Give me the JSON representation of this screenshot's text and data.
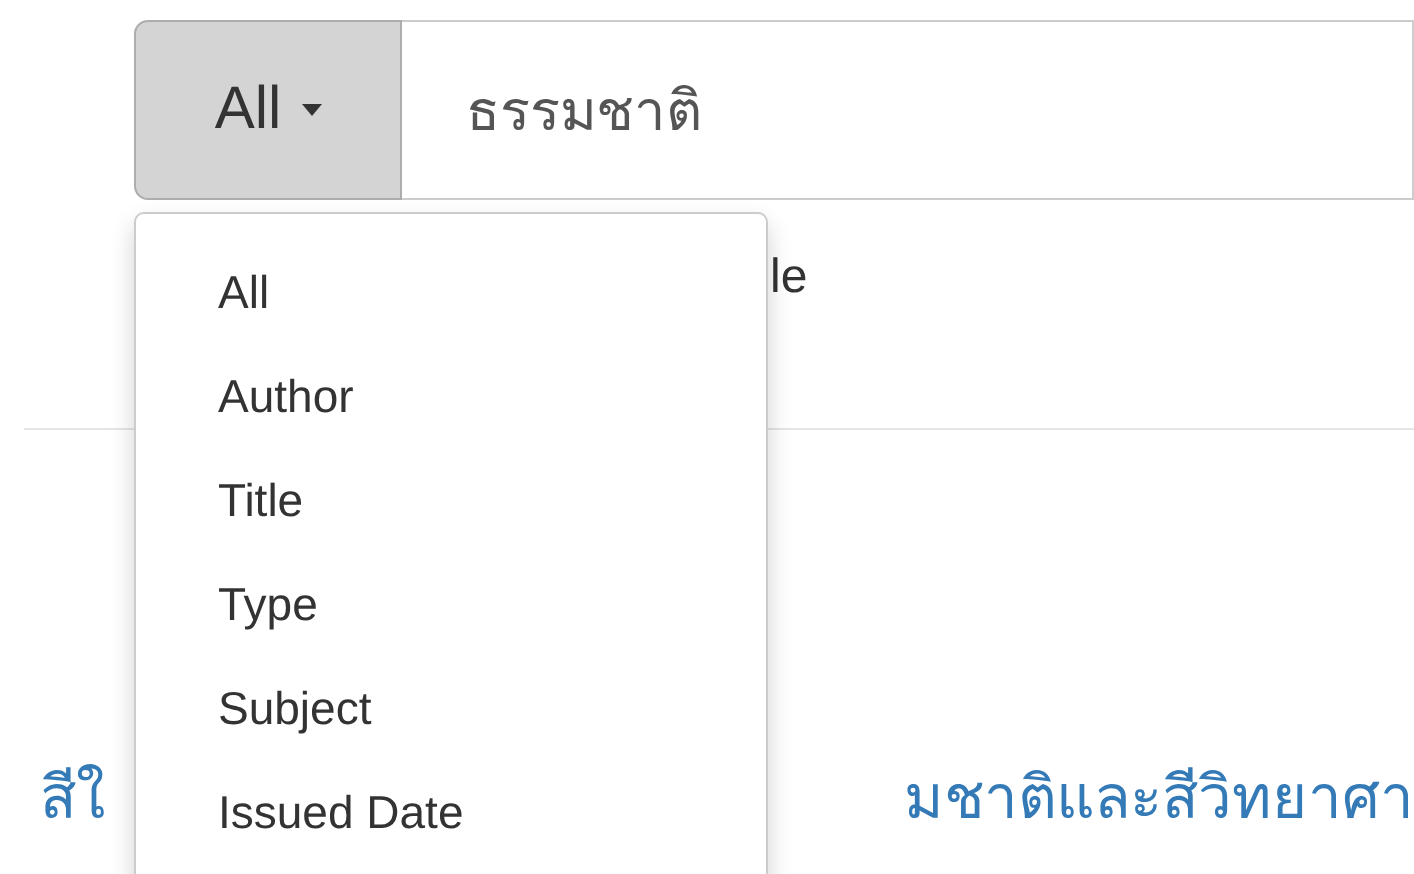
{
  "search": {
    "scope_button": "All",
    "value": "ธรรมชาติ"
  },
  "scope_menu": {
    "items": [
      {
        "label": "All"
      },
      {
        "label": "Author"
      },
      {
        "label": "Title"
      },
      {
        "label": "Type"
      },
      {
        "label": "Subject"
      },
      {
        "label": "Issued Date"
      }
    ]
  },
  "behind_menu": {
    "option_text": "le",
    "result_link_left": "สีใ",
    "result_link_right": "มชาติและสีวิทยาศา"
  }
}
